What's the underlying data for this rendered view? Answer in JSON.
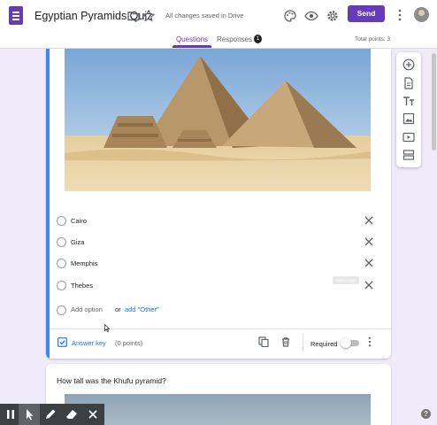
{
  "header": {
    "title": "Egyptian Pyramids Quiz",
    "saved_status": "All changes saved in Drive",
    "send_label": "Send",
    "icons": [
      "folder-icon",
      "star-icon",
      "palette-icon",
      "eye-icon",
      "gear-icon",
      "more-vert-icon"
    ]
  },
  "tabs": {
    "questions": "Questions",
    "responses": "Responses",
    "responses_count": "1",
    "total_points": "Total points: 3"
  },
  "question": {
    "options": [
      "Cairo",
      "Giza",
      "Memphis",
      "Thebes"
    ],
    "add_option": "Add option",
    "or": "or",
    "add_other": "add \"Other\"",
    "tooltip": "Add image",
    "answer_key": "Answer key",
    "points": "(0 points)",
    "required_label": "Required",
    "required": false
  },
  "next_question": {
    "title": "How tall was the Khufu pyramid?"
  },
  "colors": {
    "accent": "#673ab7",
    "active_card_bar": "#4285f4",
    "link": "#1a73e8",
    "background": "#f0ebf8"
  },
  "side_toolbar": [
    "add-question-icon",
    "import-questions-icon",
    "add-title-icon",
    "add-image-icon",
    "add-video-icon",
    "add-section-icon"
  ],
  "annotation_toolbar": [
    "pause-icon",
    "pointer-icon",
    "pen-icon",
    "eraser-icon",
    "close-icon"
  ]
}
